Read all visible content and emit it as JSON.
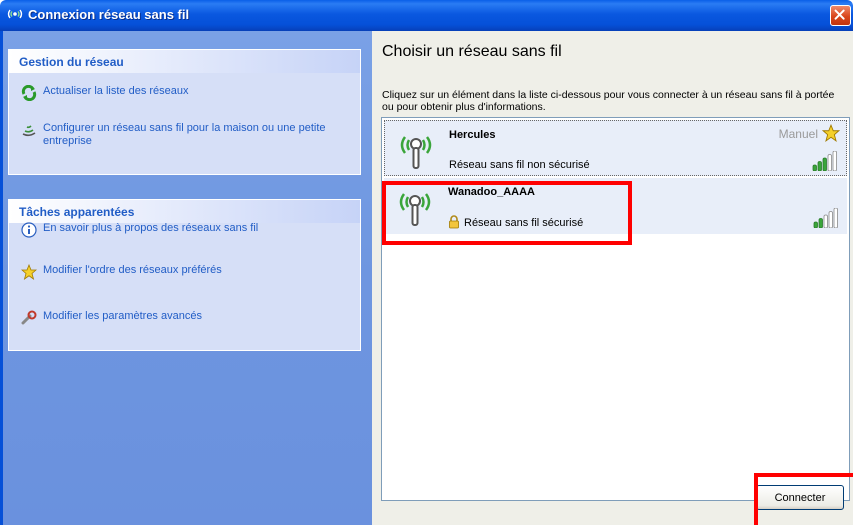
{
  "window": {
    "title": "Connexion réseau sans fil",
    "icon": "wireless-network-icon",
    "close_icon": "close-icon"
  },
  "left_pane": {
    "network_tasks": {
      "title": "Gestion du réseau",
      "items": [
        {
          "label": "Actualiser la liste des réseaux",
          "icon": "refresh-icon"
        },
        {
          "label": "Configurer un réseau sans fil pour la maison ou une petite entreprise",
          "icon": "setup-wizard-icon"
        }
      ]
    },
    "related_tasks": {
      "title": "Tâches apparentées",
      "items": [
        {
          "label": "En savoir plus à propos des réseaux sans fil",
          "icon": "info-icon"
        },
        {
          "label": "Modifier l'ordre des réseaux préférés",
          "icon": "star-icon"
        },
        {
          "label": "Modifier les paramètres avancés",
          "icon": "settings-icon"
        }
      ]
    }
  },
  "main": {
    "heading": "Choisir un réseau sans fil",
    "instructions": "Cliquez sur un élément dans la liste ci-dessous pour vous connecter à un réseau sans fil à portée ou pour obtenir plus d'informations.",
    "networks": [
      {
        "name": "Hercules",
        "status": "Réseau sans fil non sécurisé",
        "mode": "Manuel",
        "secured": false,
        "signal_bars": 5,
        "signal_level": 3
      },
      {
        "name": "Wanadoo_AAAA",
        "status": "Réseau sans fil sécurisé",
        "mode": "",
        "secured": true,
        "signal_bars": 5,
        "signal_level": 2
      }
    ],
    "connect_button": "Connecter"
  },
  "colors": {
    "titlebar": "#0550d8",
    "task_link": "#215dc6",
    "highlight": "#ff0000",
    "signal_on": "#3aa53a"
  }
}
